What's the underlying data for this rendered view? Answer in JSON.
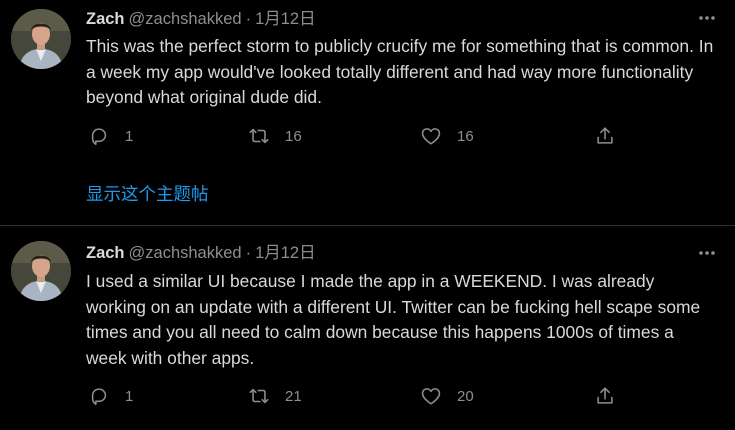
{
  "tweets": [
    {
      "author_name": "Zach",
      "author_handle": "@zachshakked",
      "separator": "·",
      "date": "1月12日",
      "text": "This was the perfect storm to publicly crucify me for something that is common. In a week my app would've looked totally different and had way more functionality beyond what original dude did.",
      "reply_count": "1",
      "retweet_count": "16",
      "like_count": "16",
      "show_thread_label": "显示这个主题帖"
    },
    {
      "author_name": "Zach",
      "author_handle": "@zachshakked",
      "separator": "·",
      "date": "1月12日",
      "text": "I used a similar UI because I made the app in a WEEKEND. I was already working on an update with a different UI. Twitter can be fucking hell scape some times and you all need to calm down because this happens 1000s of times a week with other apps.",
      "reply_count": "1",
      "retweet_count": "21",
      "like_count": "20"
    }
  ],
  "icons": {
    "reply": "reply-icon",
    "retweet": "retweet-icon",
    "like": "like-icon",
    "share": "share-icon",
    "more": "more-options-icon"
  },
  "colors": {
    "background": "#000000",
    "text": "#d9d9d9",
    "secondary": "#8b8f93",
    "link": "#1d9bf0",
    "divider": "#2f3336"
  }
}
